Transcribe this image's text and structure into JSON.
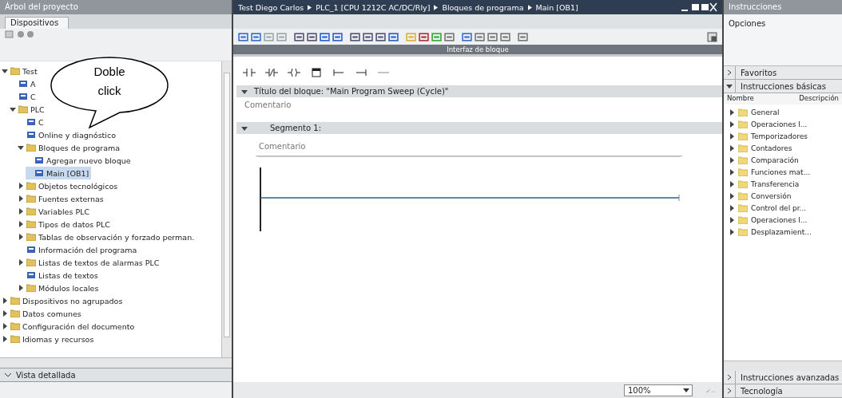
{
  "project_tree": {
    "title": "Árbol del proyecto",
    "tab": "Dispositivos",
    "items": [
      {
        "label": "Test",
        "kind": "folder",
        "expanded": true,
        "selected": false,
        "children": [
          {
            "label": "A",
            "kind": "leaf",
            "selected": false
          },
          {
            "label": "C",
            "kind": "leaf",
            "selected": false
          },
          {
            "label": "PLC",
            "kind": "folder",
            "expanded": true,
            "selected": false,
            "children": [
              {
                "label": "C",
                "kind": "leaf",
                "selected": false
              },
              {
                "label": "Online y diagnóstico",
                "kind": "leaf",
                "selected": false
              },
              {
                "label": "Bloques de programa",
                "kind": "folder",
                "expanded": true,
                "selected": false,
                "children": [
                  {
                    "label": "Agregar nuevo bloque",
                    "kind": "leaf",
                    "selected": false
                  },
                  {
                    "label": "Main [OB1]",
                    "kind": "leaf",
                    "selected": true
                  }
                ]
              },
              {
                "label": "Objetos tecnológicos",
                "kind": "folder",
                "expanded": false,
                "selected": false
              },
              {
                "label": "Fuentes externas",
                "kind": "folder",
                "expanded": false,
                "selected": false
              },
              {
                "label": "Variables PLC",
                "kind": "folder",
                "expanded": false,
                "selected": false
              },
              {
                "label": "Tipos de datos PLC",
                "kind": "folder",
                "expanded": false,
                "selected": false
              },
              {
                "label": "Tablas de observación y forzado perman.",
                "kind": "folder",
                "expanded": false,
                "selected": false
              },
              {
                "label": "Información del programa",
                "kind": "leaf",
                "selected": false
              },
              {
                "label": "Listas de textos de alarmas PLC",
                "kind": "folder",
                "expanded": false,
                "selected": false
              },
              {
                "label": "Listas de textos",
                "kind": "leaf",
                "selected": false
              },
              {
                "label": "Módulos locales",
                "kind": "folder",
                "expanded": false,
                "selected": false
              }
            ]
          }
        ]
      },
      {
        "label": "Dispositivos no agrupados",
        "kind": "folder",
        "expanded": false,
        "selected": false
      },
      {
        "label": "Datos comunes",
        "kind": "folder",
        "expanded": false,
        "selected": false
      },
      {
        "label": "Configuración del documento",
        "kind": "folder",
        "expanded": false,
        "selected": false
      },
      {
        "label": "Idiomas y recursos",
        "kind": "folder",
        "expanded": false,
        "selected": false
      }
    ],
    "details_view": "Vista detallada"
  },
  "callout": {
    "text": "Doble click"
  },
  "editor": {
    "breadcrumb": [
      "Test Diego Carlos",
      "PLC_1 [CPU 1212C AC/DC/Rly]",
      "Bloques de programa",
      "Main [OB1]"
    ],
    "interface_bar": "Interfaz de bloque",
    "block_title": "Título del bloque: \"Main Program Sweep (Cycle)\"",
    "block_comment": "Comentario",
    "segment": {
      "title": "Segmento 1:",
      "expanded": true,
      "comment": "Comentario"
    },
    "zoom": "100%"
  },
  "instructions": {
    "title": "Instrucciones",
    "options": "Opciones",
    "sections_top": [
      {
        "label": "Favoritos",
        "expanded": false
      },
      {
        "label": "Instrucciones básicas",
        "expanded": true
      }
    ],
    "columns": [
      "Nombre",
      "Descripción"
    ],
    "items": [
      {
        "label": "General"
      },
      {
        "label": "Operaciones l..."
      },
      {
        "label": "Temporizadores"
      },
      {
        "label": "Contadores"
      },
      {
        "label": "Comparación"
      },
      {
        "label": "Funciones mat..."
      },
      {
        "label": "Transferencia"
      },
      {
        "label": "Conversión"
      },
      {
        "label": "Control del pr..."
      },
      {
        "label": "Operaciones l..."
      },
      {
        "label": "Desplazamient..."
      }
    ],
    "sections_bottom": [
      {
        "label": "Instrucciones avanzadas",
        "expanded": false
      },
      {
        "label": "Tecnología",
        "expanded": false
      }
    ]
  }
}
